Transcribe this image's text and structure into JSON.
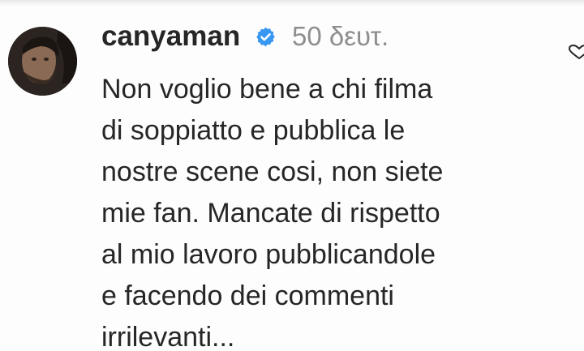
{
  "comment": {
    "username": "canyaman",
    "verified_icon": "verified-badge-icon",
    "timestamp": "50 δευτ.",
    "text_lines": [
      "Non voglio bene a chi filma",
      "di soppiatto e pubblica le",
      "nostre scene cosi, non siete",
      "mie fan. Mancate di rispetto",
      "al mio lavoro pubblicandole",
      "e facendo dei commenti",
      "irrilevanti..."
    ],
    "like_icon": "heart-icon"
  },
  "colors": {
    "text": "#262626",
    "muted": "#8e8e8e",
    "verified_blue": "#3897f0"
  }
}
